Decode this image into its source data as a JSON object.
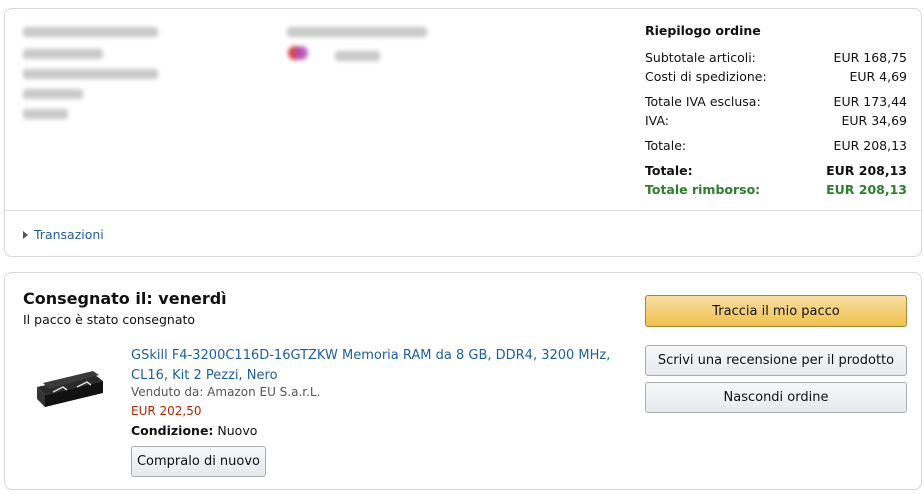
{
  "summary": {
    "title": "Riepilogo ordine",
    "rows": [
      {
        "label": "Subtotale articoli:",
        "value": "EUR 168,75"
      },
      {
        "label": "Costi di spedizione:",
        "value": "EUR 4,69"
      },
      {
        "label": "Totale IVA esclusa:",
        "value": "EUR 173,44"
      },
      {
        "label": "IVA:",
        "value": "EUR 34,69"
      },
      {
        "label": "Totale:",
        "value": "EUR 208,13"
      },
      {
        "label": "Totale:",
        "value": "EUR 208,13"
      },
      {
        "label": "Totale rimborso:",
        "value": "EUR 208,13"
      }
    ]
  },
  "transactions": {
    "label": "Transazioni"
  },
  "delivery": {
    "title": "Consegnato il: venerdì",
    "subtitle": "Il pacco è stato consegnato"
  },
  "product": {
    "title": "GSkill F4-3200C116D-16GTZKW Memoria RAM da 8 GB, DDR4, 3200 MHz, CL16, Kit 2 Pezzi, Nero",
    "sold_by": "Venduto da: Amazon EU S.a.r.L.",
    "price": "EUR 202,50",
    "condition_label": "Condizione:",
    "condition_value": " Nuovo",
    "buy_again": "Compralo di nuovo"
  },
  "actions": {
    "track": "Traccia il mio pacco",
    "review": "Scrivi una recensione per il prodotto",
    "hide": "Nascondi ordine"
  },
  "colors": {
    "link": "#1f5e9e",
    "price": "#b12704",
    "refund": "#2c7f2c",
    "primary_button": "#f0c14b"
  }
}
